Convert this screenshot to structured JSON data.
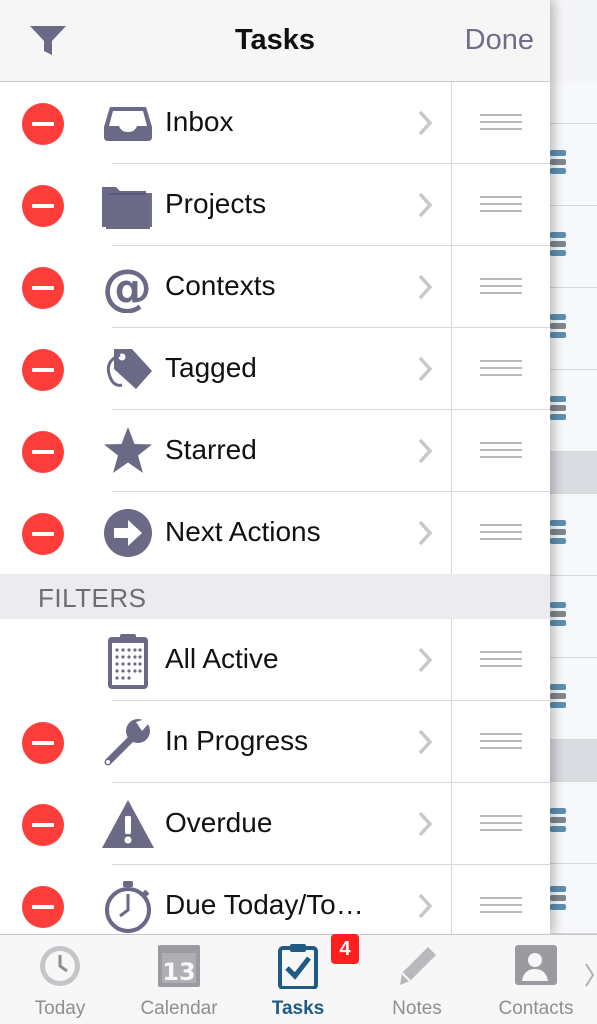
{
  "header": {
    "title": "Tasks",
    "done_label": "Done"
  },
  "lists": [
    {
      "label": "Inbox",
      "icon": "inbox-icon",
      "deletable": true
    },
    {
      "label": "Projects",
      "icon": "folder-icon",
      "deletable": true
    },
    {
      "label": "Contexts",
      "icon": "at-sign-icon",
      "deletable": true
    },
    {
      "label": "Tagged",
      "icon": "tag-icon",
      "deletable": true
    },
    {
      "label": "Starred",
      "icon": "star-icon",
      "deletable": true
    },
    {
      "label": "Next Actions",
      "icon": "arrow-circle-icon",
      "deletable": true
    }
  ],
  "filters_header": "FILTERS",
  "filters": [
    {
      "label": "All Active",
      "icon": "checklist-icon",
      "deletable": false
    },
    {
      "label": "In Progress",
      "icon": "wrench-icon",
      "deletable": true
    },
    {
      "label": "Overdue",
      "icon": "warning-icon",
      "deletable": true
    },
    {
      "label": "Due Today/To…",
      "icon": "stopwatch-icon",
      "deletable": true
    }
  ],
  "tabbar": {
    "tabs": [
      {
        "label": "Today",
        "icon": "clock-icon",
        "active": false
      },
      {
        "label": "Calendar",
        "icon": "calendar-icon",
        "day": "13",
        "active": false
      },
      {
        "label": "Tasks",
        "icon": "clipboard-check-icon",
        "active": true
      },
      {
        "label": "Notes",
        "icon": "pencil-icon",
        "active": false
      },
      {
        "label": "Contacts",
        "icon": "contact-card-icon",
        "active": false
      }
    ],
    "tasks_badge": "4"
  },
  "colors": {
    "accent": "#1f5b84",
    "icon": "#6a6986",
    "delete": "#fc3d39",
    "badge": "#ff1f1f"
  }
}
